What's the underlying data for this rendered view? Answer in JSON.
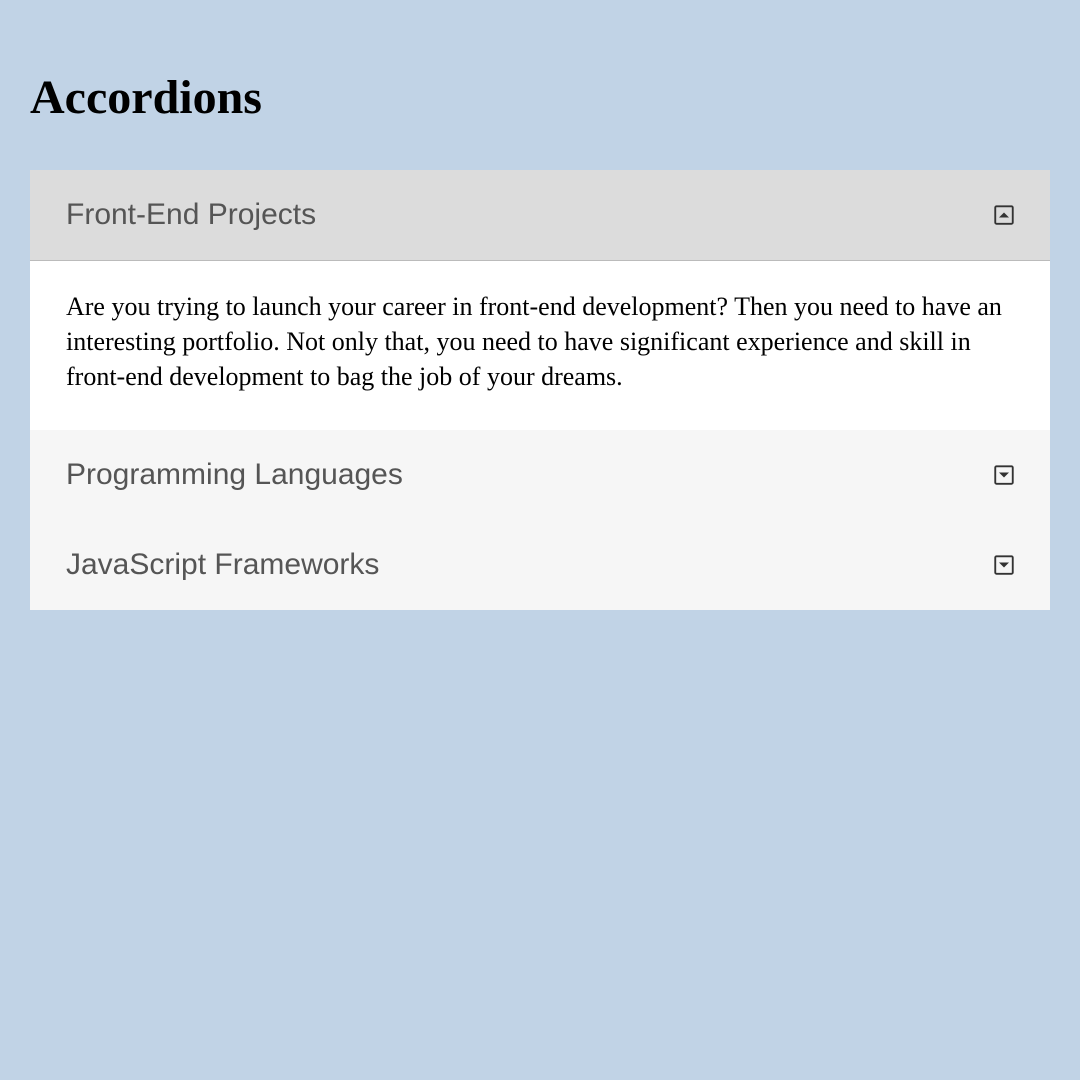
{
  "page": {
    "title": "Accordions"
  },
  "accordion": {
    "items": [
      {
        "title": "Front-End Projects",
        "expanded": true,
        "content": "Are you trying to launch your career in front-end development? Then you need to have an interesting portfolio. Not only that, you need to have significant experience and skill in front-end development to bag the job of your dreams."
      },
      {
        "title": "Programming Languages",
        "expanded": false
      },
      {
        "title": "JavaScript Frameworks",
        "expanded": false
      }
    ]
  },
  "colors": {
    "background": "#c1d3e6",
    "accordion_bg": "#f6f6f6",
    "accordion_active_bg": "#dcdcdc",
    "content_bg": "#ffffff",
    "title_color": "#555555"
  }
}
